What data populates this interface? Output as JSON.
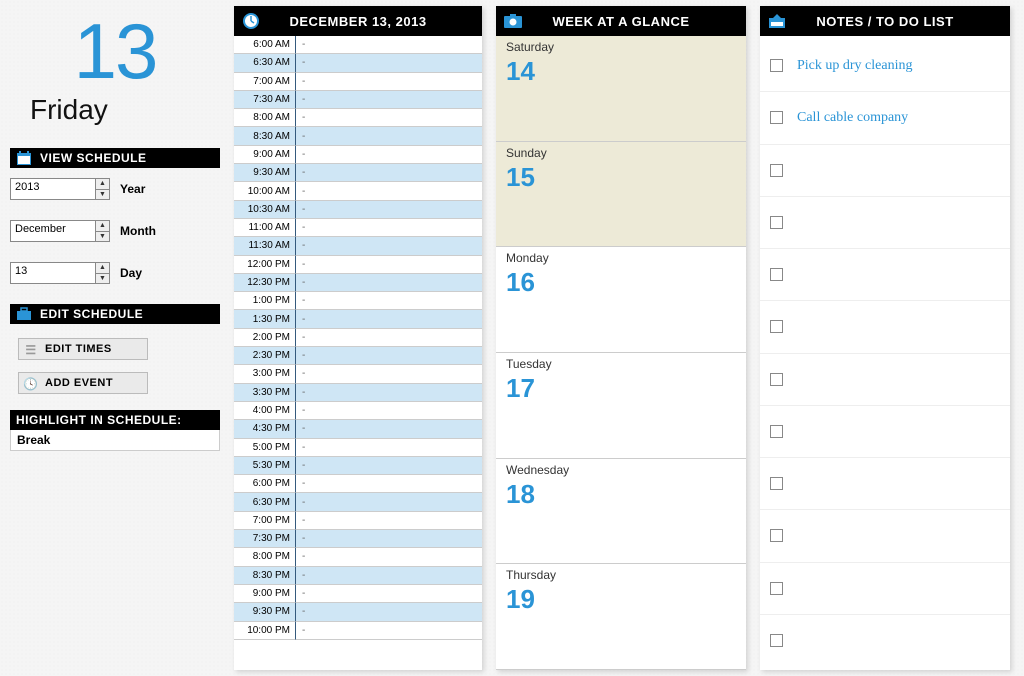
{
  "accent": "#2a94d6",
  "date": {
    "number": "13",
    "day_name": "Friday"
  },
  "sidebar": {
    "view_header": "VIEW SCHEDULE",
    "year": {
      "value": "2013",
      "label": "Year"
    },
    "month": {
      "value": "December",
      "label": "Month"
    },
    "day": {
      "value": "13",
      "label": "Day"
    },
    "edit_header": "EDIT SCHEDULE",
    "edit_times_btn": "EDIT TIMES",
    "add_event_btn": "ADD EVENT",
    "highlight_header": "HIGHLIGHT IN SCHEDULE:",
    "highlight_value": "Break"
  },
  "schedule": {
    "title": "DECEMBER 13, 2013",
    "slots": [
      {
        "t": "6:00 AM",
        "e": "-",
        "alt": false
      },
      {
        "t": "6:30 AM",
        "e": "-",
        "alt": true
      },
      {
        "t": "7:00 AM",
        "e": "-",
        "alt": false
      },
      {
        "t": "7:30 AM",
        "e": "-",
        "alt": true
      },
      {
        "t": "8:00 AM",
        "e": "-",
        "alt": false
      },
      {
        "t": "8:30 AM",
        "e": "-",
        "alt": true
      },
      {
        "t": "9:00 AM",
        "e": "-",
        "alt": false
      },
      {
        "t": "9:30 AM",
        "e": "-",
        "alt": true
      },
      {
        "t": "10:00 AM",
        "e": "-",
        "alt": false
      },
      {
        "t": "10:30 AM",
        "e": "-",
        "alt": true
      },
      {
        "t": "11:00 AM",
        "e": "-",
        "alt": false
      },
      {
        "t": "11:30 AM",
        "e": "-",
        "alt": true
      },
      {
        "t": "12:00 PM",
        "e": "-",
        "alt": false
      },
      {
        "t": "12:30 PM",
        "e": "-",
        "alt": true
      },
      {
        "t": "1:00 PM",
        "e": "-",
        "alt": false
      },
      {
        "t": "1:30 PM",
        "e": "-",
        "alt": true
      },
      {
        "t": "2:00 PM",
        "e": "-",
        "alt": false
      },
      {
        "t": "2:30 PM",
        "e": "-",
        "alt": true
      },
      {
        "t": "3:00 PM",
        "e": "-",
        "alt": false
      },
      {
        "t": "3:30 PM",
        "e": "-",
        "alt": true
      },
      {
        "t": "4:00 PM",
        "e": "-",
        "alt": false
      },
      {
        "t": "4:30 PM",
        "e": "-",
        "alt": true
      },
      {
        "t": "5:00 PM",
        "e": "-",
        "alt": false
      },
      {
        "t": "5:30 PM",
        "e": "-",
        "alt": true
      },
      {
        "t": "6:00 PM",
        "e": "-",
        "alt": false
      },
      {
        "t": "6:30 PM",
        "e": "-",
        "alt": true
      },
      {
        "t": "7:00 PM",
        "e": "-",
        "alt": false
      },
      {
        "t": "7:30 PM",
        "e": "-",
        "alt": true
      },
      {
        "t": "8:00 PM",
        "e": "-",
        "alt": false
      },
      {
        "t": "8:30 PM",
        "e": "-",
        "alt": true
      },
      {
        "t": "9:00 PM",
        "e": "-",
        "alt": false
      },
      {
        "t": "9:30 PM",
        "e": "-",
        "alt": true
      },
      {
        "t": "10:00 PM",
        "e": "-",
        "alt": false
      }
    ]
  },
  "week": {
    "title": "WEEK AT A GLANCE",
    "days": [
      {
        "name": "Saturday",
        "num": "14",
        "weekend": true
      },
      {
        "name": "Sunday",
        "num": "15",
        "weekend": true
      },
      {
        "name": "Monday",
        "num": "16",
        "weekend": false
      },
      {
        "name": "Tuesday",
        "num": "17",
        "weekend": false
      },
      {
        "name": "Wednesday",
        "num": "18",
        "weekend": false
      },
      {
        "name": "Thursday",
        "num": "19",
        "weekend": false
      }
    ]
  },
  "notes": {
    "title": "NOTES / TO DO LIST",
    "items": [
      {
        "text": "Pick up dry cleaning"
      },
      {
        "text": "Call cable company"
      },
      {
        "text": ""
      },
      {
        "text": ""
      },
      {
        "text": ""
      },
      {
        "text": ""
      },
      {
        "text": ""
      },
      {
        "text": ""
      },
      {
        "text": ""
      },
      {
        "text": ""
      },
      {
        "text": ""
      },
      {
        "text": ""
      }
    ]
  }
}
